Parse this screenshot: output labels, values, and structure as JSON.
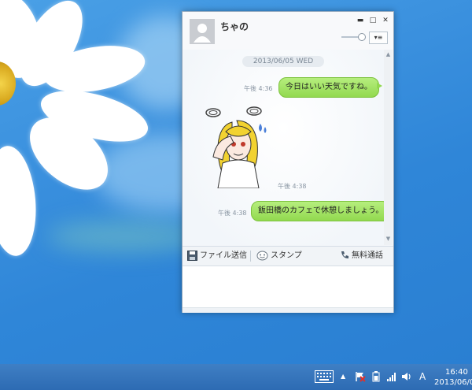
{
  "window": {
    "contact_name": "ちゃの",
    "controls": {
      "minimize": "▬",
      "maximize": "□",
      "close": "✕"
    },
    "volume_level": 0.85,
    "menu_label": "▾≡"
  },
  "chat": {
    "date": "2013/06/05 WED",
    "messages": [
      {
        "time": "午後 4:36",
        "text": "今日はいい天気ですね。",
        "kind": "sent"
      },
      {
        "time": "午後 4:38",
        "kind": "sticker-received"
      },
      {
        "time": "午後 4:38",
        "text": "飯田橋のカフェで休憩しましょう。",
        "kind": "sent"
      }
    ]
  },
  "toolbar": {
    "file_send": "ファイル送信",
    "stamp": "スタンプ",
    "free_call": "無料通話"
  },
  "taskbar": {
    "ime": "A",
    "clock_time": "16:40",
    "clock_date": "2013/06/0"
  }
}
